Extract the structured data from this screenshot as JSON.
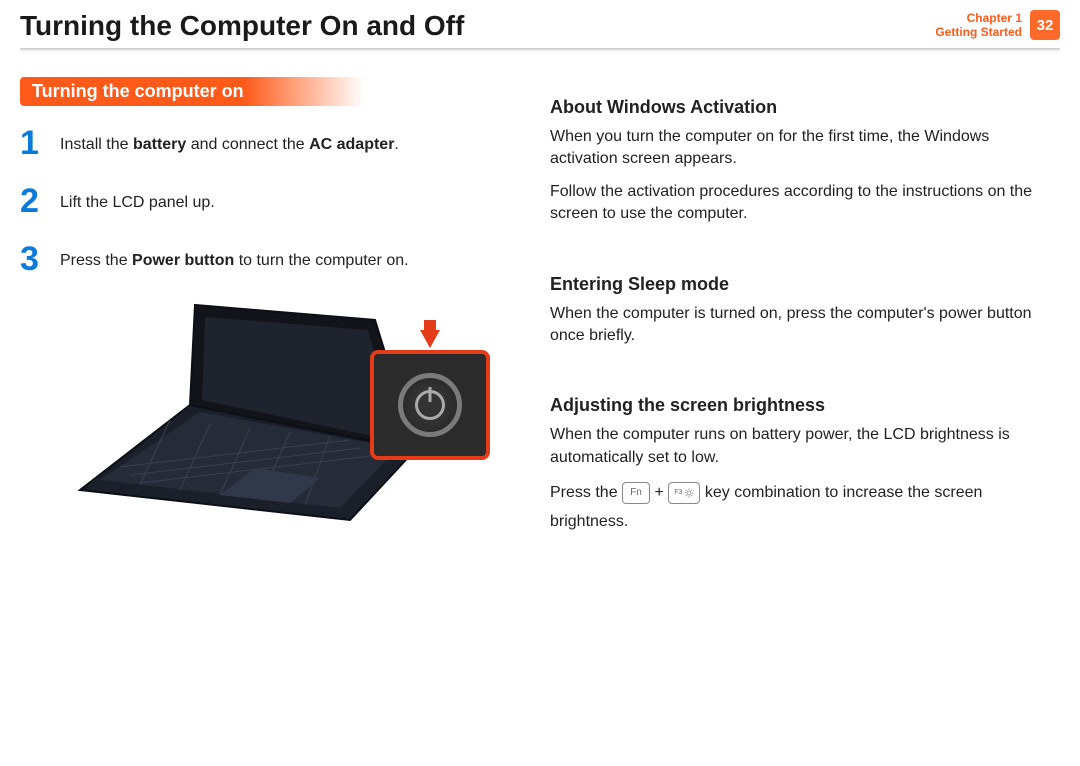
{
  "header": {
    "title": "Turning the Computer On and Off",
    "chapter_line1": "Chapter 1",
    "chapter_line2": "Getting Started",
    "page_number": "32"
  },
  "left": {
    "banner": "Turning the computer on",
    "steps": [
      {
        "num": "1",
        "html": "Install the <b>battery</b> and connect the <b>AC adapter</b>."
      },
      {
        "num": "2",
        "html": "Lift the LCD panel up."
      },
      {
        "num": "3",
        "html": "Press the <b>Power button</b> to turn the computer on."
      }
    ]
  },
  "right": {
    "sec1_head": "About Windows Activation",
    "sec1_p1": "When you turn the computer on for the first time, the Windows activation screen appears.",
    "sec1_p2": "Follow the activation procedures according to the instructions on the screen to use the computer.",
    "sec2_head": "Entering Sleep mode",
    "sec2_p1": "When the computer is turned on, press the computer's power button once briefly.",
    "sec3_head": "Adjusting the screen brightness",
    "sec3_p1": "When the computer runs on battery power, the LCD brightness is automatically set to low.",
    "press_prefix": "Press the ",
    "key_fn": "Fn",
    "plus": " + ",
    "key_f3": "F3",
    "press_suffix": " key combination to increase the screen brightness."
  }
}
